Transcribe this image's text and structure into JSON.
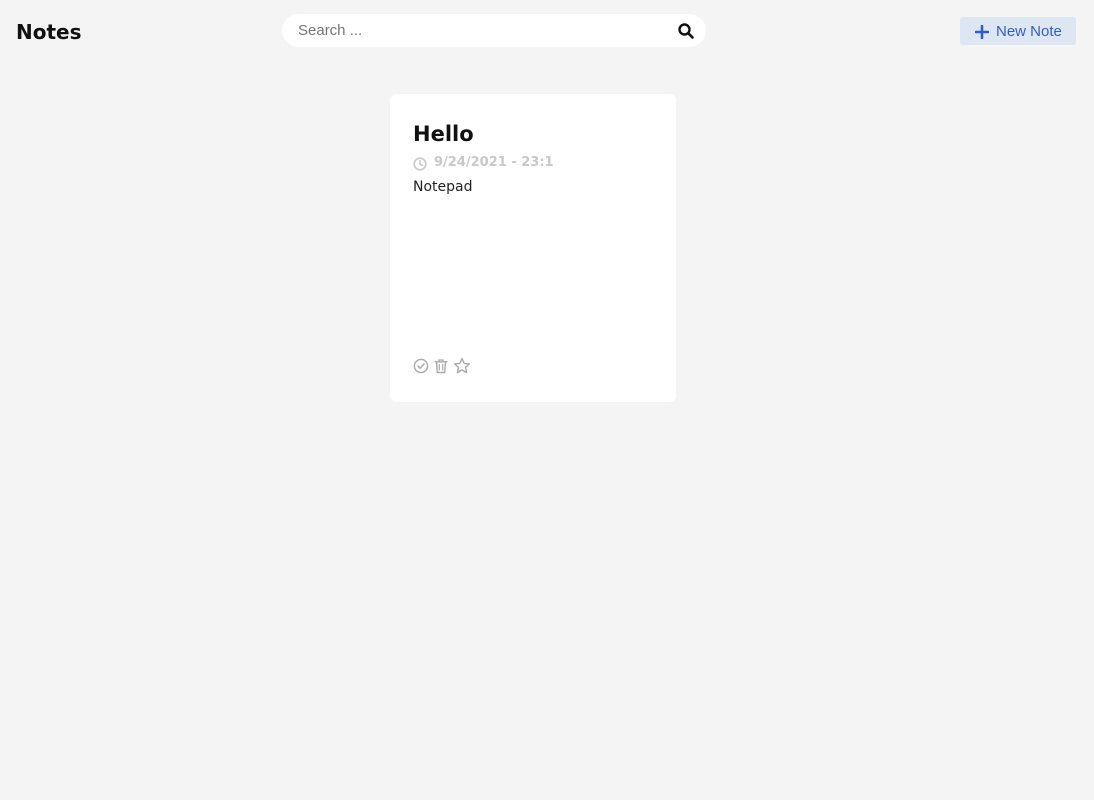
{
  "header": {
    "app_title": "Notes",
    "search": {
      "placeholder": "Search ...",
      "value": "",
      "icon": "search-icon"
    },
    "new_note_button": {
      "label": "New Note",
      "icon": "plus-icon"
    }
  },
  "notes": [
    {
      "title": "Hello",
      "date": "9/24/2021 - 23:1",
      "body": "Notepad",
      "actions": [
        {
          "icon": "check-circle-icon"
        },
        {
          "icon": "trash-icon"
        },
        {
          "icon": "star-icon"
        }
      ]
    }
  ],
  "colors": {
    "background": "#f4f4f4",
    "card": "#ffffff",
    "accent": "#2f5fbf",
    "accent_bg": "#dfe6f3",
    "muted": "#c8c8c8"
  }
}
